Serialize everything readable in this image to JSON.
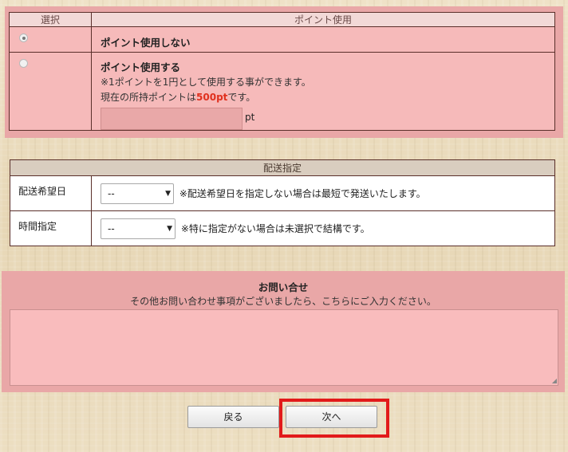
{
  "points": {
    "header_select": "選択",
    "header_use": "ポイント使用",
    "option_none": {
      "label": "ポイント使用しない",
      "selected": true
    },
    "option_use": {
      "label": "ポイント使用する",
      "note": "※1ポイントを1円として使用する事ができます。",
      "balance_prefix": "現在の所持ポイントは",
      "balance_value": "500pt",
      "balance_suffix": "です。",
      "input_value": "",
      "unit": "pt",
      "selected": false
    }
  },
  "delivery": {
    "header": "配送指定",
    "date": {
      "label": "配送希望日",
      "value": "--",
      "note": "※配送希望日を指定しない場合は最短で発送いたします。"
    },
    "time": {
      "label": "時間指定",
      "value": "--",
      "note": "※特に指定がない場合は未選択で結構です。"
    }
  },
  "inquiry": {
    "title": "お問い合せ",
    "subtitle": "その他お問い合わせ事項がございましたら、こちらにご入力ください。",
    "value": ""
  },
  "buttons": {
    "back_label": "戻る",
    "next_label": "次へ"
  },
  "colors": {
    "section_pink": "#e9a7a7",
    "cell_pink": "#f6baba",
    "highlight_red": "#e21a1a",
    "points_red": "#e0301e"
  }
}
